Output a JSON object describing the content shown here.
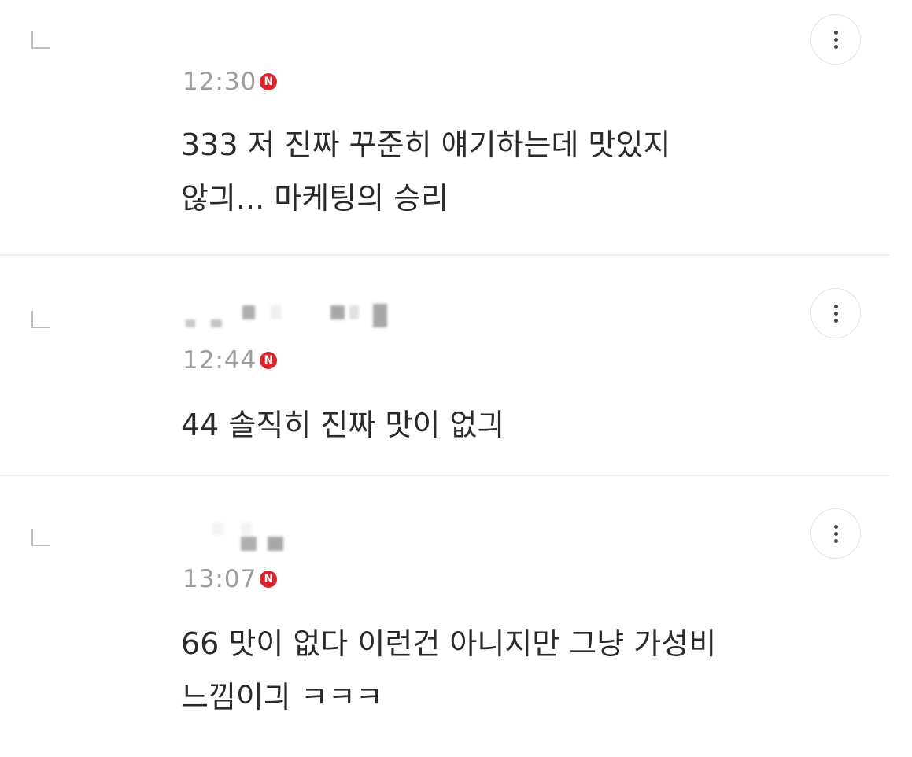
{
  "replies": [
    {
      "time": "12:30",
      "badge": "N",
      "text_line1": "333 저 진짜 꾸준히 얘기하는데 맛있지",
      "text_line2": "않긔... 마케팅의 승리"
    },
    {
      "time": "12:44",
      "badge": "N",
      "text_line1": "44 솔직히 진짜 맛이 없긔",
      "text_line2": ""
    },
    {
      "time": "13:07",
      "badge": "N",
      "text_line1": "66 맛이 없다 이런건 아니지만 그냥 가성비",
      "text_line2": "느낌이긔 ㅋㅋㅋ"
    }
  ],
  "colors": {
    "badge": "#d9242b",
    "timestamp": "#9e9e9e",
    "text": "#2a2a2a"
  },
  "icons": {
    "reply": "reply-arrow-icon",
    "more": "more-vertical-icon"
  }
}
